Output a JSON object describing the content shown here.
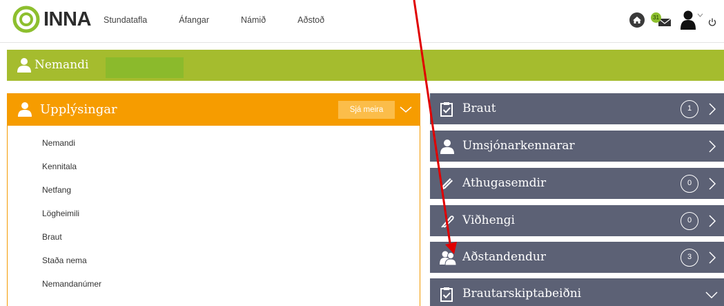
{
  "logo": {
    "text": "INNA",
    "color": "#8dbf2e"
  },
  "nav": {
    "items": [
      {
        "id": "stundatafla",
        "label": "Stundatafla"
      },
      {
        "id": "afangar",
        "label": "Áfangar"
      },
      {
        "id": "namid",
        "label": "Námið"
      },
      {
        "id": "adstod",
        "label": "Aðstoð"
      }
    ]
  },
  "top_icons": {
    "mail_badge": "31"
  },
  "student_bar": {
    "title": "Nemandi",
    "color": "#a5bc2e"
  },
  "info_panel": {
    "title": "Upplýsingar",
    "see_more": "Sjá meira",
    "color": "#f69c00",
    "items": [
      "Nemandi",
      "Kennitala",
      "Netfang",
      "Lögheimili",
      "Braut",
      "Staða nema",
      "Nemandanúmer"
    ]
  },
  "right_panels": [
    {
      "id": "braut",
      "title": "Braut",
      "icon": "clipboard-check-icon",
      "count": "1",
      "chevron": "right"
    },
    {
      "id": "umsjonarkennarar",
      "title": "Umsjónarkennarar",
      "icon": "user-icon",
      "count": "",
      "chevron": "right"
    },
    {
      "id": "athugasemdir",
      "title": "Athugasemdir",
      "icon": "pencil-icon",
      "count": "0",
      "chevron": "right"
    },
    {
      "id": "vidhengi",
      "title": "Viðhengi",
      "icon": "paperclip-icon",
      "count": "0",
      "chevron": "right"
    },
    {
      "id": "adstandendur",
      "title": "Aðstandendur",
      "icon": "users-icon",
      "count": "3",
      "chevron": "right"
    },
    {
      "id": "brautarskiptabeidni",
      "title": "Brautarskiptabeiðni",
      "icon": "clipboard-check-icon",
      "count": "",
      "chevron": "down"
    }
  ],
  "colors": {
    "panel": "#5c6175",
    "arrow": "#e00000"
  }
}
